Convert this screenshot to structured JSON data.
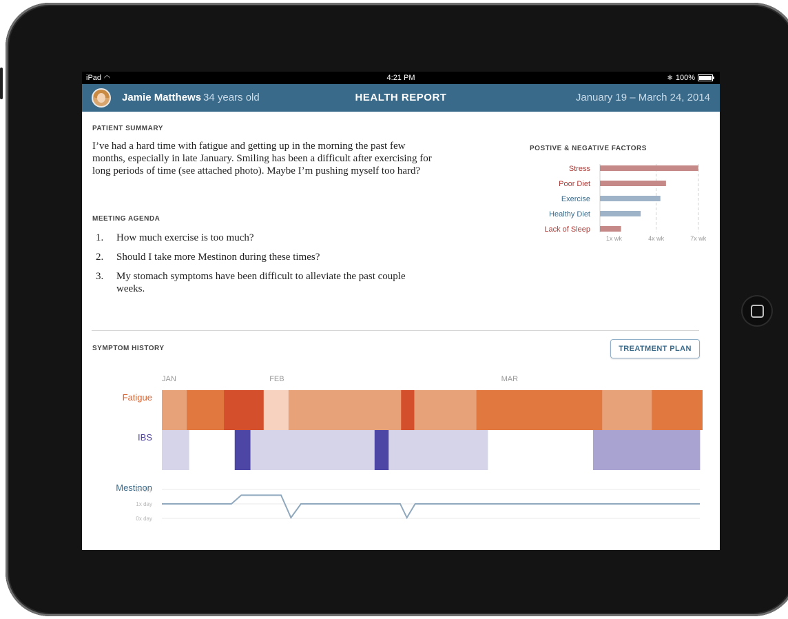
{
  "status_bar": {
    "device": "iPad",
    "time": "4:21 PM",
    "battery": "100%"
  },
  "header": {
    "patient_name": "Jamie Matthews",
    "patient_age": "34 years old",
    "title": "HEALTH REPORT",
    "date_range": "January 19 – March 24, 2014"
  },
  "patient_summary": {
    "heading": "PATIENT SUMMARY",
    "text": "I’ve had a hard time with fatigue and getting up in the morning the past few months, especially in late January. Smiling has been a difficult after exercising for long periods of time (see attached photo). Maybe I’m pushing myself too hard?"
  },
  "meeting_agenda": {
    "heading": "MEETING AGENDA",
    "items": [
      {
        "num": "1.",
        "text": "How much exercise is too much?"
      },
      {
        "num": "2.",
        "text": "Should I take more Mestinon during these times?"
      },
      {
        "num": "3.",
        "text": "My stomach symptoms have been difficult to alleviate the past couple weeks."
      }
    ]
  },
  "factors": {
    "heading": "POSTIVE & NEGATIVE FACTORS",
    "colors": {
      "negative_bar": "#c58a88",
      "negative_label": "#b03a36",
      "positive_bar": "#9fb3c8",
      "positive_label": "#3a6a8a"
    },
    "chart_data": {
      "type": "bar",
      "orientation": "horizontal",
      "categories": [
        "Stress",
        "Poor Diet",
        "Exercise",
        "Healthy Diet",
        "Lack of Sleep"
      ],
      "values": [
        7,
        4.7,
        4.3,
        2.9,
        1.5
      ],
      "polarity": [
        "negative",
        "negative",
        "positive",
        "positive",
        "negative"
      ],
      "x_ticks": [
        "1x wk",
        "4x wk",
        "7x wk"
      ],
      "x_tick_values": [
        1,
        4,
        7
      ],
      "xlim": [
        0,
        7.5
      ]
    }
  },
  "symptom_history": {
    "heading": "SYMPTOM HISTORY",
    "treatment_button": "TREATMENT PLAN",
    "months": [
      "JAN",
      "FEB",
      "MAR"
    ],
    "chart_data": {
      "type": "heatmap",
      "timeline_days": 65,
      "month_starts_day": [
        0,
        13,
        41
      ],
      "rows": [
        {
          "name": "Fatigue",
          "label_color": "#d9602c",
          "segments": [
            {
              "days": 3,
              "color": "#e8a27a"
            },
            {
              "days": 4.5,
              "color": "#e07840"
            },
            {
              "days": 4.8,
              "color": "#d4502c"
            },
            {
              "days": 3,
              "color": "#f6d2bf"
            },
            {
              "days": 13.6,
              "color": "#e8a27a"
            },
            {
              "days": 1.6,
              "color": "#d4502c"
            },
            {
              "days": 7.5,
              "color": "#e8a27a"
            },
            {
              "days": 15.2,
              "color": "#e07840"
            },
            {
              "days": 6,
              "color": "#e8a27a"
            },
            {
              "days": 6.1,
              "color": "#e07840"
            }
          ]
        },
        {
          "name": "IBS",
          "label_color": "#4a3f9a",
          "segments": [
            {
              "days": 3.3,
              "color": "#d6d4e8"
            },
            {
              "days": 5.5,
              "color": "#ffffff"
            },
            {
              "days": 1.9,
              "color": "#4e46a4"
            },
            {
              "days": 15,
              "color": "#d6d4e8"
            },
            {
              "days": 1.7,
              "color": "#4e46a4"
            },
            {
              "days": 12,
              "color": "#d6d4e8"
            },
            {
              "days": 12.7,
              "color": "#ffffff"
            },
            {
              "days": 12.9,
              "color": "#a8a3d0"
            }
          ]
        }
      ]
    },
    "mestinon": {
      "label": "Mestinon",
      "label_color": "#3a6a8a",
      "y_ticks": [
        "2x day",
        "1x day",
        "0x day"
      ],
      "chart_data": {
        "type": "line",
        "x": [
          0,
          8.4,
          9.6,
          14.4,
          15.6,
          16.8,
          28.8,
          29.6,
          30.6,
          65
        ],
        "y": [
          1,
          1,
          1.6,
          1.6,
          0.05,
          1,
          1,
          0.05,
          1,
          1
        ],
        "ylim": [
          0,
          2
        ]
      }
    }
  }
}
